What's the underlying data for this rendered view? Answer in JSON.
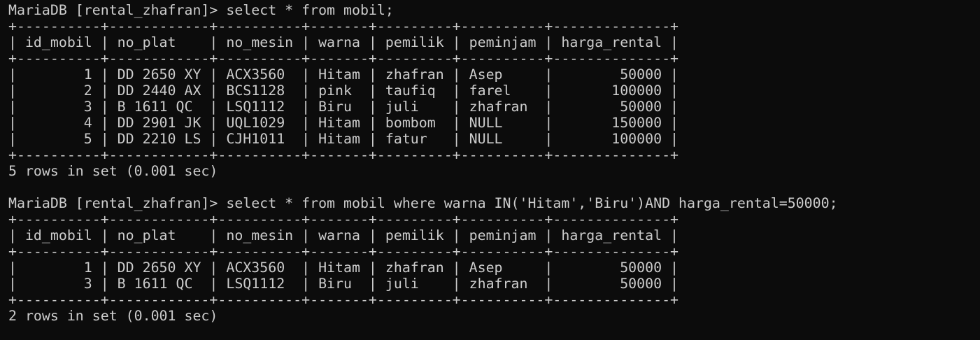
{
  "terminal": {
    "lines": [
      "MariaDB [rental_zhafran]> select * from mobil;",
      "+----------+------------+----------+-------+---------+----------+--------------+",
      "| id_mobil | no_plat    | no_mesin | warna | pemilik | peminjam | harga_rental |",
      "+----------+------------+----------+-------+---------+----------+--------------+",
      "|        1 | DD 2650 XY | ACX3560  | Hitam | zhafran | Asep     |        50000 |",
      "|        2 | DD 2440 AX | BCS1128  | pink  | taufiq  | farel    |       100000 |",
      "|        3 | B 1611 QC  | LSQ1112  | Biru  | juli    | zhafran  |        50000 |",
      "|        4 | DD 2901 JK | UQL1029  | Hitam | bombom  | NULL     |       150000 |",
      "|        5 | DD 2210 LS | CJH1011  | Hitam | fatur   | NULL     |       100000 |",
      "+----------+------------+----------+-------+---------+----------+--------------+",
      "5 rows in set (0.001 sec)",
      "",
      "MariaDB [rental_zhafran]> select * from mobil where warna IN('Hitam','Biru')AND harga_rental=50000;",
      "+----------+------------+----------+-------+---------+----------+--------------+",
      "| id_mobil | no_plat    | no_mesin | warna | pemilik | peminjam | harga_rental |",
      "+----------+------------+----------+-------+---------+----------+--------------+",
      "|        1 | DD 2650 XY | ACX3560  | Hitam | zhafran | Asep     |        50000 |",
      "|        3 | B 1611 QC  | LSQ1112  | Biru  | juli    | zhafran  |        50000 |",
      "+----------+------------+----------+-------+---------+----------+--------------+",
      "2 rows in set (0.001 sec)"
    ]
  },
  "colors": {
    "background": "#0c0c0c",
    "foreground": "#cccccc"
  }
}
